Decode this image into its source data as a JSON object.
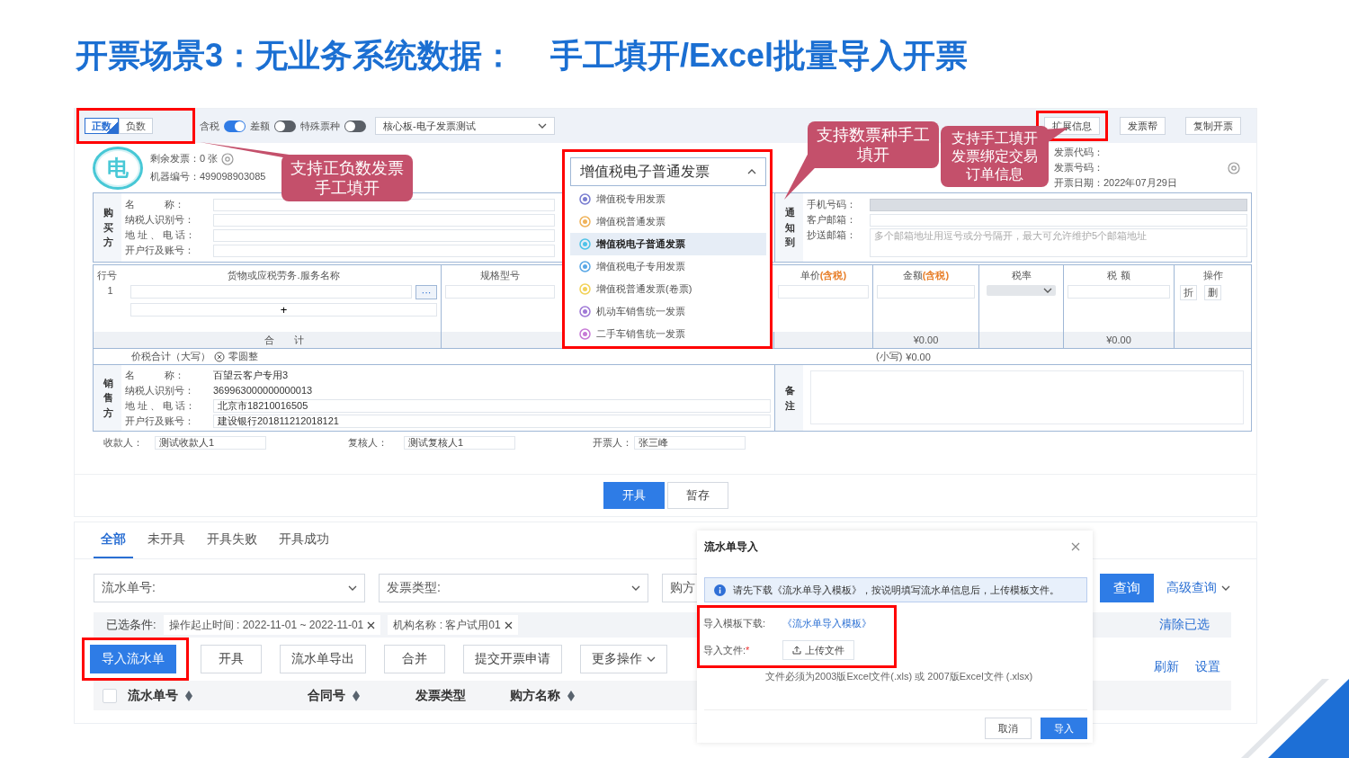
{
  "slide_title": "开票场景3：无业务系统数据：    手工填开/Excel批量导入开票",
  "invoice_form": {
    "sign_toggle": {
      "highlighted": true,
      "options": [
        {
          "label": "正数",
          "selected": true
        },
        {
          "label": "负数",
          "selected": false
        }
      ]
    },
    "switches": [
      {
        "label": "含税",
        "on": true
      },
      {
        "label": "差额",
        "on": false
      },
      {
        "label": "特殊票种",
        "on": false
      }
    ],
    "org_select": {
      "value": "核心板-电子发票测试"
    },
    "top_buttons": [
      {
        "label": "扩展信息",
        "highlighted": true
      },
      {
        "label": "发票帮",
        "highlighted": false
      },
      {
        "label": "复制开票",
        "highlighted": false
      }
    ],
    "badge": "电",
    "remaining": "剩余发票：0 张",
    "machine_no": "机器编号：499098903085",
    "invoice_meta": [
      "发票代码：",
      "发票号码：",
      "开票日期：2022年07月29日"
    ],
    "invoice_type": {
      "value": "增值税电子普通发票",
      "expanded": true,
      "highlighted": true,
      "options": [
        {
          "label": "增值税专用发票",
          "color": "#7b7fd1",
          "selected": false
        },
        {
          "label": "增值税普通发票",
          "color": "#f0b35a",
          "selected": false
        },
        {
          "label": "增值税电子普通发票",
          "color": "#4fc3e8",
          "selected": true
        },
        {
          "label": "增值税电子专用发票",
          "color": "#5aa8e6",
          "selected": false
        },
        {
          "label": "增值税普通发票(卷票)",
          "color": "#f2d25a",
          "selected": false
        },
        {
          "label": "机动车销售统一发票",
          "color": "#a07ad6",
          "selected": false
        },
        {
          "label": "二手车销售统一发票",
          "color": "#c77ad6",
          "selected": false
        }
      ]
    },
    "buyer": {
      "heading": "购买方",
      "fields": [
        "名　　　称：",
        "纳税人识别号：",
        "地 址 、 电 话：",
        "开户行及账号："
      ]
    },
    "notify": {
      "heading": "通知到",
      "fields": [
        {
          "label": "手机号码：",
          "disabled": true
        },
        {
          "label": "客户邮箱：",
          "disabled": false
        },
        {
          "label": "抄送邮箱：",
          "disabled": false,
          "placeholder": "多个邮箱地址用逗号或分号隔开，最大可允许维护5个邮箱地址"
        }
      ]
    },
    "items": {
      "columns": [
        {
          "label": "行号"
        },
        {
          "label": "货物或应税劳务.服务名称"
        },
        {
          "label": "规格型号"
        },
        {
          "label": "单价",
          "note": "(含税)"
        },
        {
          "label": "金额",
          "note": "(含税)"
        },
        {
          "label": "税率"
        },
        {
          "label": "税 额"
        },
        {
          "label": "操作"
        }
      ],
      "rows": [
        {
          "number": "1",
          "actions": [
            "折",
            "删"
          ]
        }
      ],
      "more": "···",
      "add_row": "+",
      "total_label": "合　　计",
      "total_amount": "¥0.00",
      "total_tax": "¥0.00"
    },
    "grand_total": {
      "label": "价税合计（大写）",
      "upper": "零圆整",
      "lower_label": "(小写)",
      "lower": "¥0.00"
    },
    "seller": {
      "heading": "销售方",
      "fields": [
        {
          "label": "名　　　称：",
          "value": "百望云客户专用3",
          "editable": false
        },
        {
          "label": "纳税人识别号：",
          "value": "369963000000000013",
          "editable": false
        },
        {
          "label": "地 址 、 电 话：",
          "value": "北京市18210016505",
          "editable": true
        },
        {
          "label": "开户行及账号：",
          "value": "建设银行201811212018121",
          "editable": true
        }
      ]
    },
    "remark": {
      "heading": "备注"
    },
    "signers": [
      {
        "label": "收款人：",
        "value": "测试收款人1"
      },
      {
        "label": "复核人：",
        "value": "测试复核人1"
      },
      {
        "label": "开票人：",
        "value": "张三峰"
      }
    ],
    "actions": [
      {
        "label": "开具",
        "primary": true
      },
      {
        "label": "暂存",
        "primary": false
      }
    ]
  },
  "callouts": [
    {
      "text": "支持正负数发票手工填开"
    },
    {
      "text": "支持数票种手工填开"
    },
    {
      "text": "支持手工填开发票绑定交易订单信息"
    }
  ],
  "flow_list": {
    "tabs": [
      {
        "label": "全部",
        "selected": true
      },
      {
        "label": "未开具",
        "selected": false
      },
      {
        "label": "开具失败",
        "selected": false
      },
      {
        "label": "开具成功",
        "selected": false
      }
    ],
    "filters": [
      {
        "placeholder": "流水单号:"
      },
      {
        "placeholder": "发票类型:"
      },
      {
        "placeholder": "购方"
      }
    ],
    "search_button": "查询",
    "advanced": "高级查询",
    "conditions_label": "已选条件:",
    "chips": [
      "操作起止时间 : 2022-11-01 ~ 2022-11-01",
      "机构名称 : 客户试用01"
    ],
    "clear": "清除已选",
    "buttons": [
      {
        "label": "导入流水单",
        "primary": true,
        "highlighted": true,
        "menu": false
      },
      {
        "label": "开具",
        "primary": false,
        "highlighted": false,
        "menu": false
      },
      {
        "label": "流水单导出",
        "primary": false,
        "highlighted": false,
        "menu": false
      },
      {
        "label": "合并",
        "primary": false,
        "highlighted": false,
        "menu": false
      },
      {
        "label": "提交开票申请",
        "primary": false,
        "highlighted": false,
        "menu": false
      },
      {
        "label": "更多操作",
        "primary": false,
        "highlighted": false,
        "menu": true
      }
    ],
    "links": [
      "刷新",
      "设置"
    ],
    "select_all": {
      "checked": false
    },
    "columns": [
      {
        "label": "流水单号",
        "sortable": true
      },
      {
        "label": "合同号",
        "sortable": true
      },
      {
        "label": "发票类型",
        "sortable": false
      },
      {
        "label": "购方名称",
        "sortable": true
      }
    ]
  },
  "import_dialog": {
    "title": "流水单导入",
    "notice": "请先下载《流水单导入模板》，按说明填写流水单信息后，上传模板文件。",
    "highlighted": true,
    "template_label": "导入模板下载:",
    "template_link": "《流水单导入模板》",
    "file_label": "导入文件:",
    "required_mark": "*",
    "upload": "上传文件",
    "hint": "文件必须为2003版Excel文件(.xls) 或 2007版Excel文件 (.xlsx)",
    "buttons": [
      {
        "label": "取消",
        "primary": false
      },
      {
        "label": "导入",
        "primary": true
      }
    ]
  }
}
